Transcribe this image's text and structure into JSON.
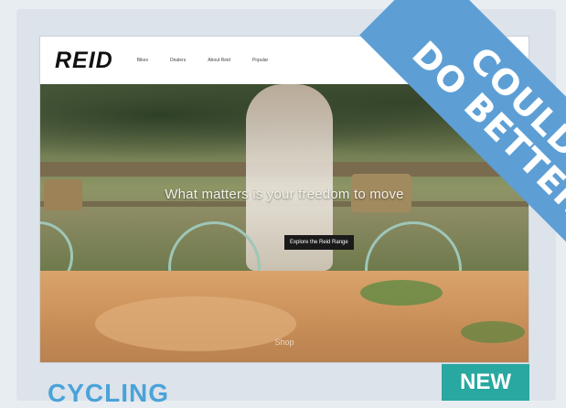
{
  "website": {
    "logo": "REID",
    "nav": [
      "Bikes",
      "Dealers",
      "About Reid",
      "Popular"
    ],
    "hero_tagline": "What matters is your freedom to move",
    "cta_label": "Explore the Reid Range",
    "lower_caption": "Shop"
  },
  "ribbon": {
    "line1": "COULD",
    "line2": "DO BETTER",
    "color": "#5d9fd5"
  },
  "badge": {
    "label": "NEW",
    "color": "#28a8a0"
  },
  "section_title": "CYCLING"
}
